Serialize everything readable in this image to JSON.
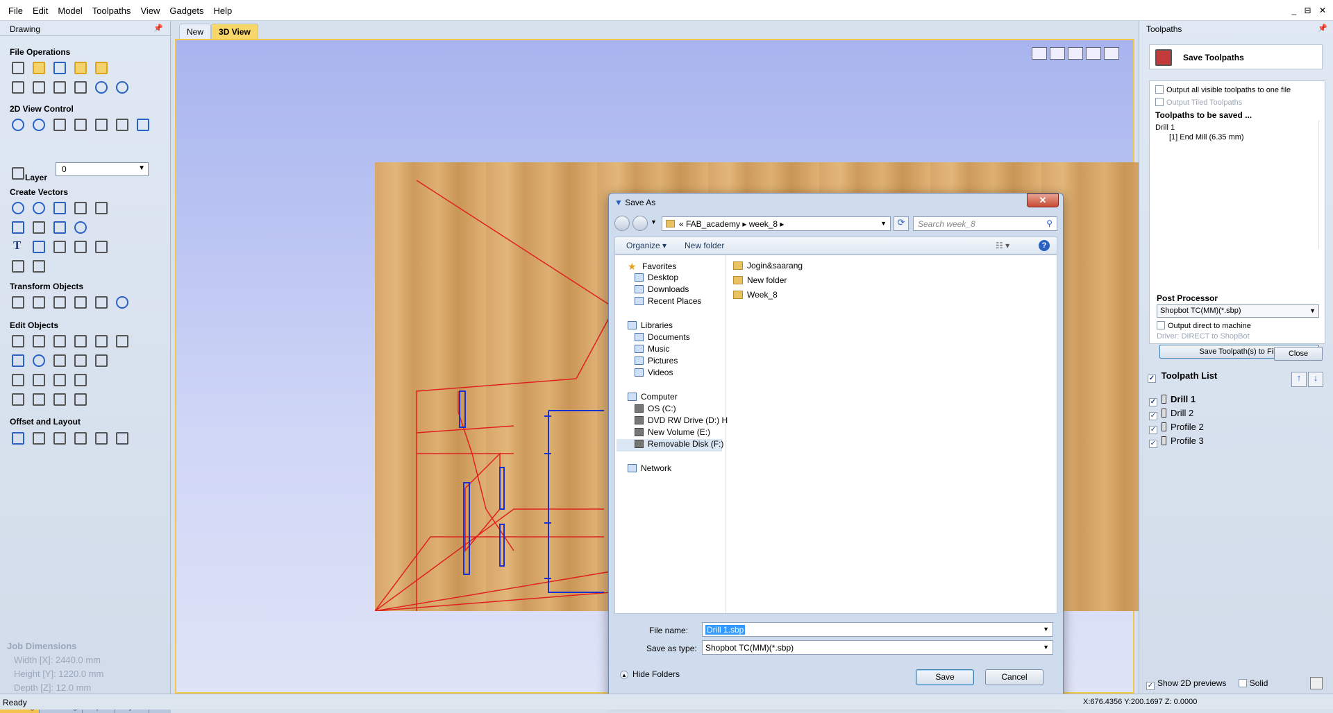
{
  "menu": [
    "File",
    "Edit",
    "Model",
    "Toolpaths",
    "View",
    "Gadgets",
    "Help"
  ],
  "window_controls": "_ ⊟ ✕",
  "left_panel": {
    "title": "Drawing",
    "sections": {
      "file_ops": "File Operations",
      "view2d": "2D View Control",
      "create_vectors": "Create Vectors",
      "transform": "Transform Objects",
      "edit": "Edit Objects",
      "offset": "Offset and Layout"
    },
    "layer_label": "Layer",
    "layer_value": "0",
    "job_dimensions": {
      "title": "Job Dimensions",
      "width": "Width  [X]: 2440.0 mm",
      "height": "Height [Y]: 1220.0 mm",
      "depth": "Depth  [Z]: 12.0 mm"
    },
    "tabs": [
      "Drawing",
      "Modeling",
      "Clipart",
      "Layers"
    ]
  },
  "view_tabs": [
    "New",
    "3D View"
  ],
  "dialog": {
    "title": "Save As",
    "breadcrumb": "« FAB_academy ▸ week_8 ▸",
    "search_placeholder": "Search week_8",
    "organize": "Organize ▾",
    "new_folder": "New folder",
    "nav": {
      "favorites": "Favorites",
      "desktop": "Desktop",
      "downloads": "Downloads",
      "recent": "Recent Places",
      "libraries": "Libraries",
      "documents": "Documents",
      "music": "Music",
      "pictures": "Pictures",
      "videos": "Videos",
      "computer": "Computer",
      "os": "OS (C:)",
      "dvd": "DVD RW Drive (D:) H",
      "newvol": "New Volume (E:)",
      "removable": "Removable Disk (F:)",
      "network": "Network"
    },
    "files": [
      "Jogin&saarang",
      "New folder",
      "Week_8"
    ],
    "file_name_label": "File name:",
    "file_name": "Drill 1.sbp",
    "save_type_label": "Save as type:",
    "save_type": "Shopbot TC(MM)(*.sbp)",
    "hide_folders": "Hide Folders",
    "save": "Save",
    "cancel": "Cancel"
  },
  "right_panel": {
    "title": "Toolpaths",
    "save_toolpaths": "Save Toolpaths",
    "output_all": "Output all visible toolpaths to one file",
    "output_tiled": "Output Tiled Toolpaths",
    "to_be_saved": "Toolpaths to be saved ...",
    "saved_item": "Drill 1",
    "saved_tool": "[1] End Mill (6.35 mm)",
    "post_processor": "Post Processor",
    "pp_value": "Shopbot TC(MM)(*.sbp)",
    "output_direct": "Output direct to machine",
    "driver": "Driver: DIRECT to ShopBot",
    "save_to_file": "Save Toolpath(s) to File",
    "close": "Close",
    "toolpath_list": "Toolpath List",
    "toolpaths": [
      "Drill 1",
      "Drill 2",
      "Profile 2",
      "Profile 3"
    ],
    "show_2d": "Show 2D previews",
    "solid": "Solid"
  },
  "status": {
    "text": "Ready",
    "coords": "X:676.4356 Y:200.1697 Z: 0.0000"
  }
}
